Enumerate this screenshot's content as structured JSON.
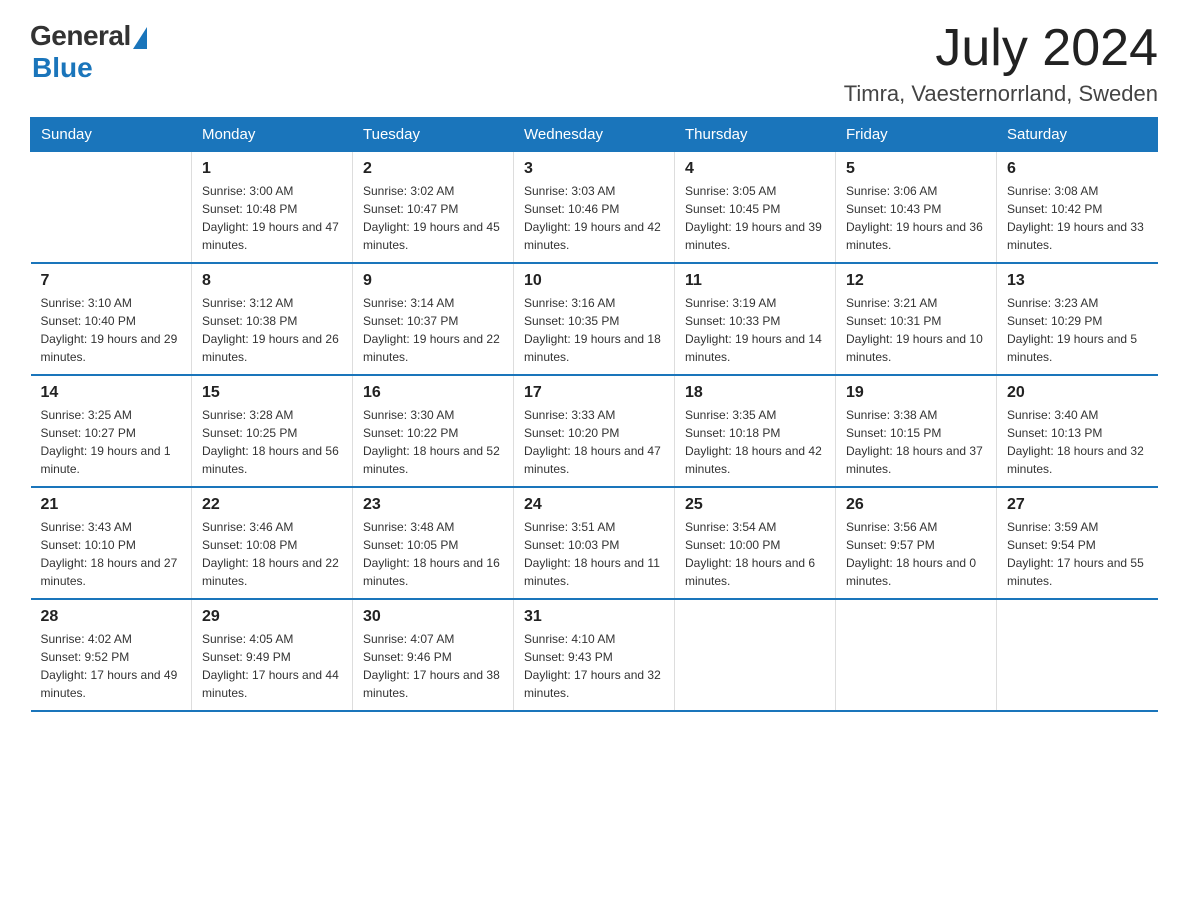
{
  "logo": {
    "general": "General",
    "blue": "Blue"
  },
  "header": {
    "month_year": "July 2024",
    "location": "Timra, Vaesternorrland, Sweden"
  },
  "days_of_week": [
    "Sunday",
    "Monday",
    "Tuesday",
    "Wednesday",
    "Thursday",
    "Friday",
    "Saturday"
  ],
  "weeks": [
    [
      {
        "day": "",
        "info": ""
      },
      {
        "day": "1",
        "info": "Sunrise: 3:00 AM\nSunset: 10:48 PM\nDaylight: 19 hours and 47 minutes."
      },
      {
        "day": "2",
        "info": "Sunrise: 3:02 AM\nSunset: 10:47 PM\nDaylight: 19 hours and 45 minutes."
      },
      {
        "day": "3",
        "info": "Sunrise: 3:03 AM\nSunset: 10:46 PM\nDaylight: 19 hours and 42 minutes."
      },
      {
        "day": "4",
        "info": "Sunrise: 3:05 AM\nSunset: 10:45 PM\nDaylight: 19 hours and 39 minutes."
      },
      {
        "day": "5",
        "info": "Sunrise: 3:06 AM\nSunset: 10:43 PM\nDaylight: 19 hours and 36 minutes."
      },
      {
        "day": "6",
        "info": "Sunrise: 3:08 AM\nSunset: 10:42 PM\nDaylight: 19 hours and 33 minutes."
      }
    ],
    [
      {
        "day": "7",
        "info": "Sunrise: 3:10 AM\nSunset: 10:40 PM\nDaylight: 19 hours and 29 minutes."
      },
      {
        "day": "8",
        "info": "Sunrise: 3:12 AM\nSunset: 10:38 PM\nDaylight: 19 hours and 26 minutes."
      },
      {
        "day": "9",
        "info": "Sunrise: 3:14 AM\nSunset: 10:37 PM\nDaylight: 19 hours and 22 minutes."
      },
      {
        "day": "10",
        "info": "Sunrise: 3:16 AM\nSunset: 10:35 PM\nDaylight: 19 hours and 18 minutes."
      },
      {
        "day": "11",
        "info": "Sunrise: 3:19 AM\nSunset: 10:33 PM\nDaylight: 19 hours and 14 minutes."
      },
      {
        "day": "12",
        "info": "Sunrise: 3:21 AM\nSunset: 10:31 PM\nDaylight: 19 hours and 10 minutes."
      },
      {
        "day": "13",
        "info": "Sunrise: 3:23 AM\nSunset: 10:29 PM\nDaylight: 19 hours and 5 minutes."
      }
    ],
    [
      {
        "day": "14",
        "info": "Sunrise: 3:25 AM\nSunset: 10:27 PM\nDaylight: 19 hours and 1 minute."
      },
      {
        "day": "15",
        "info": "Sunrise: 3:28 AM\nSunset: 10:25 PM\nDaylight: 18 hours and 56 minutes."
      },
      {
        "day": "16",
        "info": "Sunrise: 3:30 AM\nSunset: 10:22 PM\nDaylight: 18 hours and 52 minutes."
      },
      {
        "day": "17",
        "info": "Sunrise: 3:33 AM\nSunset: 10:20 PM\nDaylight: 18 hours and 47 minutes."
      },
      {
        "day": "18",
        "info": "Sunrise: 3:35 AM\nSunset: 10:18 PM\nDaylight: 18 hours and 42 minutes."
      },
      {
        "day": "19",
        "info": "Sunrise: 3:38 AM\nSunset: 10:15 PM\nDaylight: 18 hours and 37 minutes."
      },
      {
        "day": "20",
        "info": "Sunrise: 3:40 AM\nSunset: 10:13 PM\nDaylight: 18 hours and 32 minutes."
      }
    ],
    [
      {
        "day": "21",
        "info": "Sunrise: 3:43 AM\nSunset: 10:10 PM\nDaylight: 18 hours and 27 minutes."
      },
      {
        "day": "22",
        "info": "Sunrise: 3:46 AM\nSunset: 10:08 PM\nDaylight: 18 hours and 22 minutes."
      },
      {
        "day": "23",
        "info": "Sunrise: 3:48 AM\nSunset: 10:05 PM\nDaylight: 18 hours and 16 minutes."
      },
      {
        "day": "24",
        "info": "Sunrise: 3:51 AM\nSunset: 10:03 PM\nDaylight: 18 hours and 11 minutes."
      },
      {
        "day": "25",
        "info": "Sunrise: 3:54 AM\nSunset: 10:00 PM\nDaylight: 18 hours and 6 minutes."
      },
      {
        "day": "26",
        "info": "Sunrise: 3:56 AM\nSunset: 9:57 PM\nDaylight: 18 hours and 0 minutes."
      },
      {
        "day": "27",
        "info": "Sunrise: 3:59 AM\nSunset: 9:54 PM\nDaylight: 17 hours and 55 minutes."
      }
    ],
    [
      {
        "day": "28",
        "info": "Sunrise: 4:02 AM\nSunset: 9:52 PM\nDaylight: 17 hours and 49 minutes."
      },
      {
        "day": "29",
        "info": "Sunrise: 4:05 AM\nSunset: 9:49 PM\nDaylight: 17 hours and 44 minutes."
      },
      {
        "day": "30",
        "info": "Sunrise: 4:07 AM\nSunset: 9:46 PM\nDaylight: 17 hours and 38 minutes."
      },
      {
        "day": "31",
        "info": "Sunrise: 4:10 AM\nSunset: 9:43 PM\nDaylight: 17 hours and 32 minutes."
      },
      {
        "day": "",
        "info": ""
      },
      {
        "day": "",
        "info": ""
      },
      {
        "day": "",
        "info": ""
      }
    ]
  ]
}
